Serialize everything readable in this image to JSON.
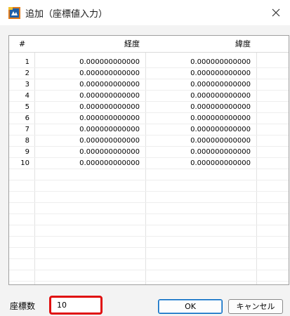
{
  "window": {
    "title": "追加（座標値入力）",
    "close_glyph": "✕"
  },
  "grid": {
    "headers": {
      "num": "#",
      "longitude": "経度",
      "latitude": "緯度"
    },
    "rows": [
      {
        "num": "1",
        "longitude": "0.000000000000",
        "latitude": "0.000000000000"
      },
      {
        "num": "2",
        "longitude": "0.000000000000",
        "latitude": "0.000000000000"
      },
      {
        "num": "3",
        "longitude": "0.000000000000",
        "latitude": "0.000000000000"
      },
      {
        "num": "4",
        "longitude": "0.000000000000",
        "latitude": "0.000000000000"
      },
      {
        "num": "5",
        "longitude": "0.000000000000",
        "latitude": "0.000000000000"
      },
      {
        "num": "6",
        "longitude": "0.000000000000",
        "latitude": "0.000000000000"
      },
      {
        "num": "7",
        "longitude": "0.000000000000",
        "latitude": "0.000000000000"
      },
      {
        "num": "8",
        "longitude": "0.000000000000",
        "latitude": "0.000000000000"
      },
      {
        "num": "9",
        "longitude": "0.000000000000",
        "latitude": "0.000000000000"
      },
      {
        "num": "10",
        "longitude": "0.000000000000",
        "latitude": "0.000000000000"
      }
    ]
  },
  "footer": {
    "count_label": "座標数",
    "count_value": "10",
    "ok_label": "OK",
    "cancel_label": "キャンセル"
  },
  "colors": {
    "highlight_border": "#e01010",
    "ok_border": "#0067c0",
    "icon_blue": "#1f5fa8",
    "icon_orange": "#e07a1a"
  },
  "icons": {
    "app": "map-app-icon",
    "close": "close-icon"
  }
}
